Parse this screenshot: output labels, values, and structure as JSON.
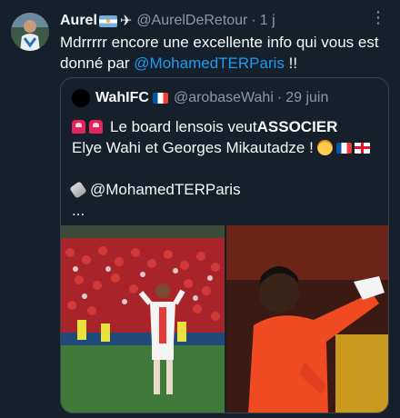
{
  "tweet": {
    "author_name": "Aurel",
    "author_handle": "@AurelDeRetour",
    "separator": "·",
    "time": "1 j",
    "more_label": "⋮",
    "text_part1": "Mdrrrrr encore une excellente info qui vous est donné par ",
    "text_mention": "@MohamedTERParis",
    "text_part2": " !!"
  },
  "quote": {
    "author_name": "WahIFC",
    "author_handle": "@arobaseWahi",
    "separator": "·",
    "time": "29 juin",
    "line1_prefix": "Le board lensois veut ",
    "line1_bold": "ASSOCIER",
    "line2": "Elye Wahi et Georges Mikautadze !",
    "line3_mention": "@MohamedTERParis",
    "ellipsis": "..."
  },
  "colors": {
    "background": "#15202b",
    "text": "#f7f9f9",
    "muted": "#8b98a5",
    "link": "#1d9bf0",
    "border": "#38444d"
  },
  "icons": [
    "argentina-flag-icon",
    "airplane-icon",
    "more-icon",
    "france-flag-icon",
    "siren-icon",
    "exploding-head-icon",
    "georgia-flag-icon",
    "pushpin-icon"
  ]
}
